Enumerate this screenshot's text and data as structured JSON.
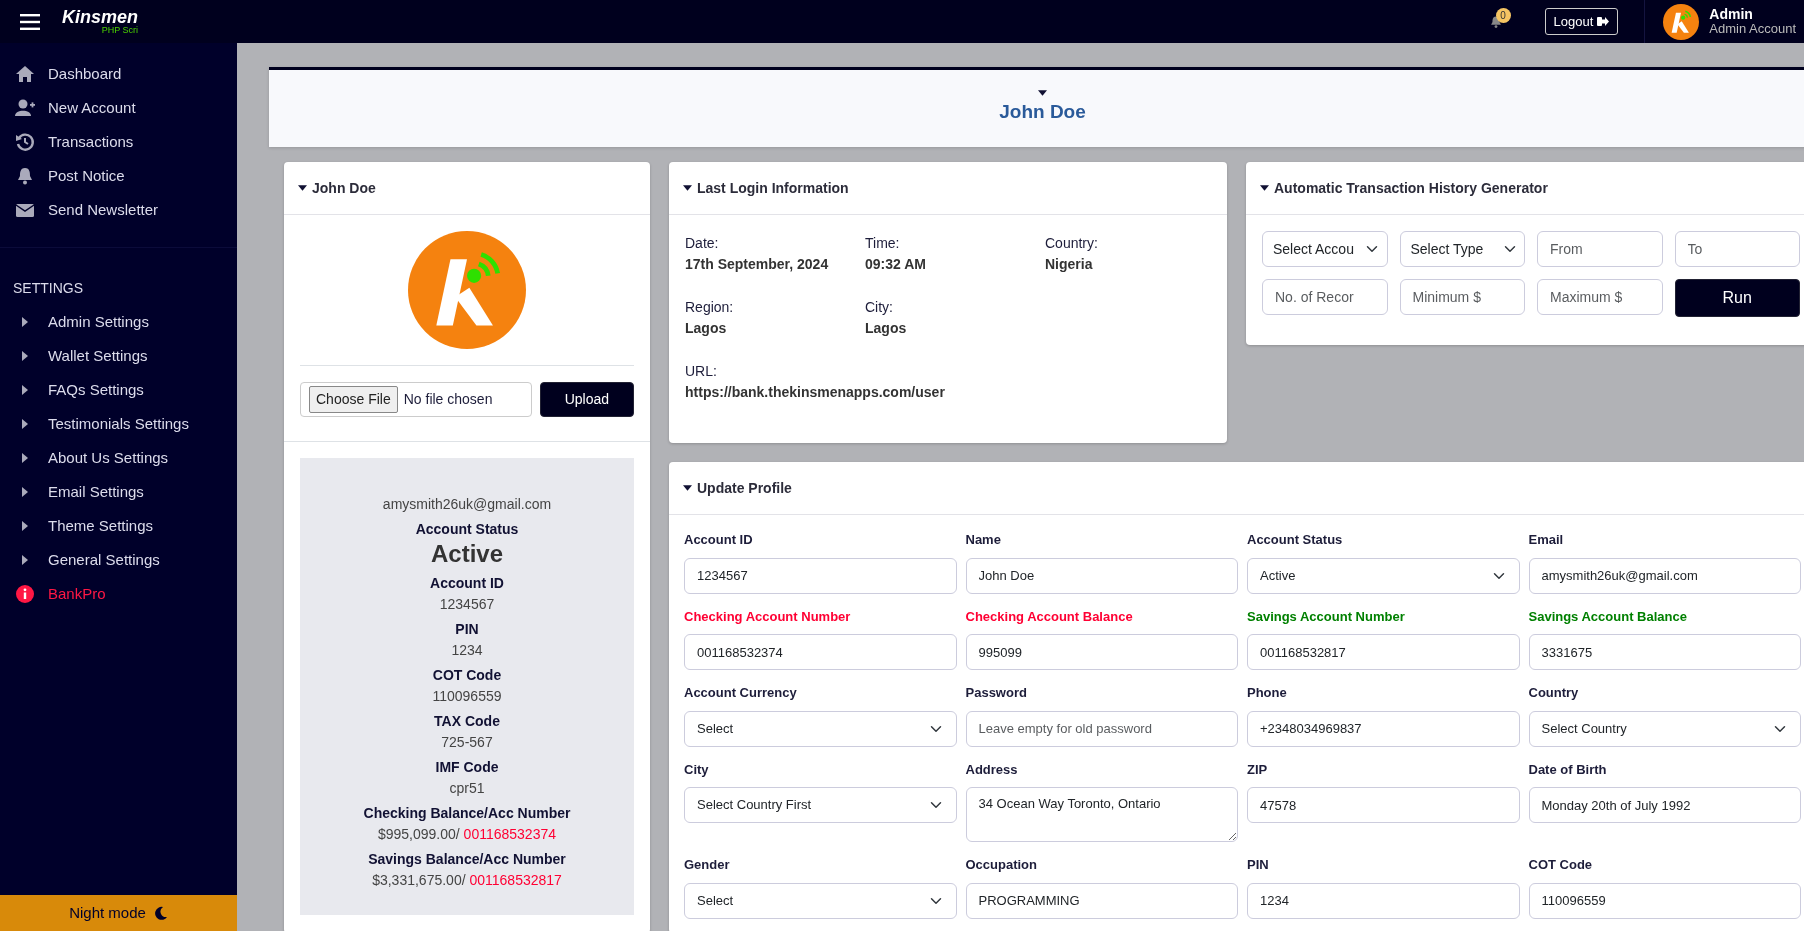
{
  "header": {
    "brand": "Kinsmen",
    "brand_sub": "PHP Scri",
    "notification_count": "0",
    "logout": "Logout",
    "user_name": "Admin",
    "user_role": "Admin Account"
  },
  "sidebar": {
    "items": [
      {
        "label": "Dashboard"
      },
      {
        "label": "New Account"
      },
      {
        "label": "Transactions"
      },
      {
        "label": "Post Notice"
      },
      {
        "label": "Send Newsletter"
      }
    ],
    "section": "SETTINGS",
    "settings": [
      {
        "label": "Admin Settings",
        "kind": "group"
      },
      {
        "label": "Wallet Settings",
        "kind": "group"
      },
      {
        "label": "FAQs Settings",
        "kind": "group"
      },
      {
        "label": "Testimonials Settings",
        "kind": "group"
      },
      {
        "label": "About Us Settings",
        "kind": "group"
      },
      {
        "label": "Email Settings",
        "kind": "group"
      },
      {
        "label": "Theme Settings",
        "kind": "group"
      },
      {
        "label": "General Settings",
        "kind": "group"
      },
      {
        "label": "BankPro",
        "kind": "alert"
      }
    ],
    "night_mode": "Night mode"
  },
  "page_title": "John Doe",
  "profile_card": {
    "title": "John Doe",
    "choose_file": "Choose File",
    "file_status": "No file chosen",
    "upload": "Upload",
    "email": "amysmith26uk@gmail.com",
    "details": [
      {
        "label": "Account Status",
        "value": "Active",
        "kind": "status"
      },
      {
        "label": "Account ID",
        "value": "1234567",
        "kind": "plain"
      },
      {
        "label": "PIN",
        "value": "1234",
        "kind": "plain"
      },
      {
        "label": "COT Code",
        "value": "110096559",
        "kind": "plain"
      },
      {
        "label": "TAX Code",
        "value": "725-567",
        "kind": "plain"
      },
      {
        "label": "IMF Code",
        "value": "cpr51",
        "kind": "plain"
      },
      {
        "label": "Checking Balance/Acc Number",
        "value": "$995,099.00/",
        "account": "001168532374",
        "kind": "balance"
      },
      {
        "label": "Savings Balance/Acc Number",
        "value": "$3,331,675.00/",
        "account": "001168532817",
        "kind": "balance"
      }
    ]
  },
  "last_login": {
    "title": "Last Login Information",
    "rows": [
      [
        {
          "label": "Date:",
          "value": "17th September, 2024"
        },
        {
          "label": "Time:",
          "value": "09:32 AM"
        },
        {
          "label": "Country:",
          "value": "Nigeria"
        }
      ],
      [
        {
          "label": "Region:",
          "value": "Lagos"
        },
        {
          "label": "City:",
          "value": "Lagos"
        }
      ],
      [
        {
          "label": "URL:",
          "value": "https://bank.thekinsmenapps.com/user"
        }
      ]
    ]
  },
  "generator": {
    "title": "Automatic Transaction History Generator",
    "controls": [
      {
        "kind": "select",
        "value": "Select Accou"
      },
      {
        "kind": "select",
        "value": "Select Type"
      },
      {
        "kind": "input",
        "placeholder": "From"
      },
      {
        "kind": "input",
        "placeholder": "To"
      },
      {
        "kind": "input",
        "placeholder": "No. of Recor"
      },
      {
        "kind": "input",
        "placeholder": "Minimum $"
      },
      {
        "kind": "input",
        "placeholder": "Maximum $"
      },
      {
        "kind": "button",
        "value": "Run"
      }
    ]
  },
  "update_profile": {
    "title": "Update Profile",
    "fields": [
      {
        "label": "Account ID",
        "kind": "input",
        "value": "1234567"
      },
      {
        "label": "Name",
        "kind": "input",
        "value": "John Doe"
      },
      {
        "label": "Account Status",
        "kind": "select",
        "value": "Active"
      },
      {
        "label": "Email",
        "kind": "input",
        "value": "amysmith26uk@gmail.com"
      },
      {
        "label": "Checking Account Number",
        "kind": "input",
        "value": "001168532374",
        "color": "#ff0033"
      },
      {
        "label": "Checking Account Balance",
        "kind": "input",
        "value": "995099",
        "color": "#ff0033"
      },
      {
        "label": "Savings Account Number",
        "kind": "input",
        "value": "001168532817",
        "color": "#008000"
      },
      {
        "label": "Savings Account Balance",
        "kind": "input",
        "value": "3331675",
        "color": "#008000"
      },
      {
        "label": "Account Currency",
        "kind": "select",
        "value": "Select"
      },
      {
        "label": "Password",
        "kind": "input",
        "placeholder": "Leave empty for old password"
      },
      {
        "label": "Phone",
        "kind": "input",
        "value": "+2348034969837"
      },
      {
        "label": "Country",
        "kind": "select",
        "value": "Select Country"
      },
      {
        "label": "City",
        "kind": "select",
        "value": "Select Country First"
      },
      {
        "label": "Address",
        "kind": "textarea",
        "value": "34 Ocean Way Toronto, Ontario"
      },
      {
        "label": "ZIP",
        "kind": "input",
        "value": "47578"
      },
      {
        "label": "Date of Birth",
        "kind": "input",
        "value": "Monday 20th of July 1992"
      },
      {
        "label": "Gender",
        "kind": "select",
        "value": "Select"
      },
      {
        "label": "Occupation",
        "kind": "input",
        "value": "PROGRAMMING"
      },
      {
        "label": "PIN",
        "kind": "input",
        "value": "1234"
      },
      {
        "label": "COT Code",
        "kind": "input",
        "value": "110096559"
      }
    ]
  }
}
